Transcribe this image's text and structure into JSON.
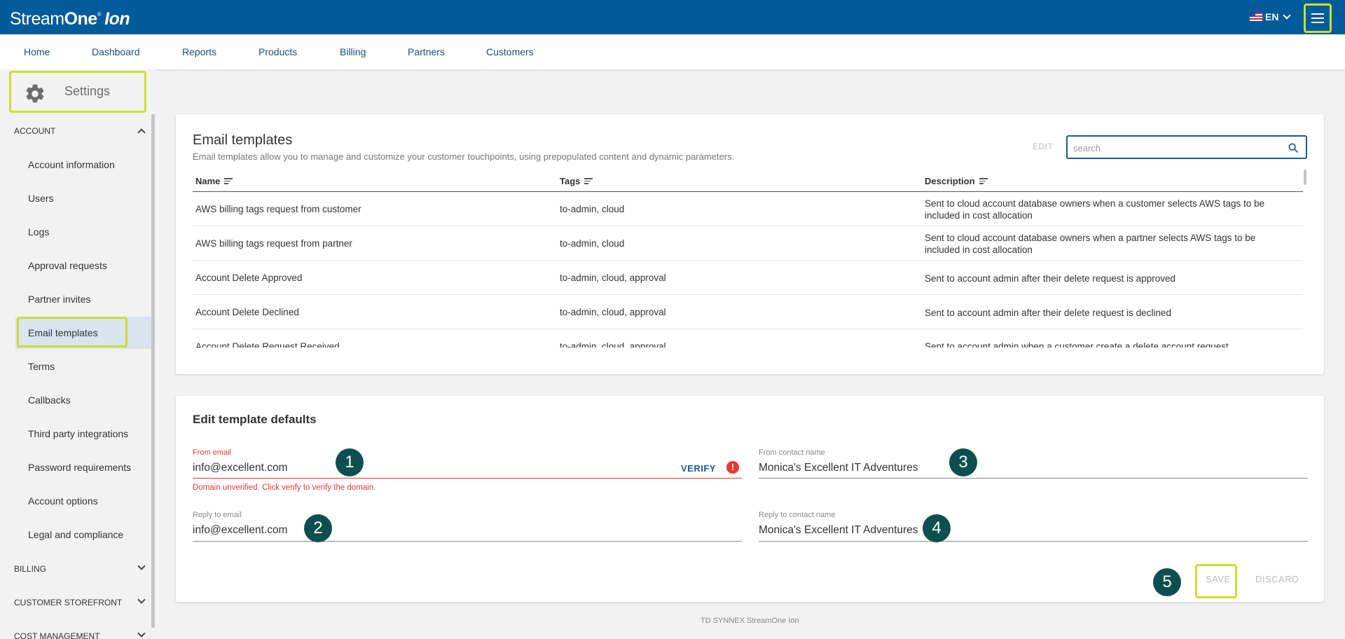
{
  "app": {
    "logo_light": "Stream",
    "logo_bold": "One",
    "logo_reg": "®",
    "logo_ion": "Ion",
    "language": "EN"
  },
  "nav": {
    "items": [
      "Home",
      "Dashboard",
      "Reports",
      "Products",
      "Billing",
      "Partners",
      "Customers"
    ]
  },
  "sidebar": {
    "title": "Settings",
    "account_section": "ACCOUNT",
    "items": [
      "Account information",
      "Users",
      "Logs",
      "Approval requests",
      "Partner invites",
      "Email templates",
      "Terms",
      "Callbacks",
      "Third party integrations",
      "Password requirements",
      "Account options",
      "Legal and compliance"
    ],
    "active_item": "Email templates",
    "billing_section": "BILLING",
    "storefront_section": "CUSTOMER STOREFRONT",
    "cost_section": "COST MANAGEMENT"
  },
  "templates": {
    "title": "Email templates",
    "subtitle": "Email templates allow you to manage and customize your customer touchpoints, using prepopulated content and dynamic parameters.",
    "edit_label": "EDIT",
    "search_placeholder": "search",
    "columns": [
      "Name",
      "Tags",
      "Description"
    ],
    "rows": [
      {
        "name": "AWS billing tags request from customer",
        "tags": "to-admin, cloud",
        "description": "Sent to cloud account database owners when a customer selects AWS tags to be included in cost allocation"
      },
      {
        "name": "AWS billing tags request from partner",
        "tags": "to-admin, cloud",
        "description": "Sent to cloud account database owners when a partner selects AWS tags to be included in cost allocation"
      },
      {
        "name": "Account Delete Approved",
        "tags": "to-admin, cloud, approval",
        "description": "Sent to account admin after their delete request is approved"
      },
      {
        "name": "Account Delete Declined",
        "tags": "to-admin, cloud, approval",
        "description": "Sent to account admin after their delete request is declined"
      },
      {
        "name": "Account Delete Request Received",
        "tags": "to-admin, cloud, approval",
        "description": "Sent to account admin when a customer create a delete account request"
      }
    ]
  },
  "edit_defaults": {
    "title": "Edit template defaults",
    "from_email_label": "From email",
    "from_email_value": "info@excellent.com",
    "verify_label": "VERIFY",
    "error_icon": "!",
    "error_text": "Domain unverified. Click verify to verify the domain.",
    "from_contact_label": "From contact name",
    "from_contact_value": "Monica's Excellent IT Adventures",
    "reply_email_label": "Reply to email",
    "reply_email_value": "info@excellent.com",
    "reply_contact_label": "Reply to contact name",
    "reply_contact_value": "Monica's Excellent IT Adventures",
    "save_label": "SAVE",
    "discard_label": "DISCARD"
  },
  "badges": [
    "1",
    "2",
    "3",
    "4",
    "5"
  ],
  "footer": "TD SYNNEX StreamOne Ion",
  "colors": {
    "header_bg": "#005b9a",
    "highlight": "#c9df31",
    "badge_bg": "#0d4f4f",
    "error": "#e53935",
    "link": "#1d5a8a"
  }
}
